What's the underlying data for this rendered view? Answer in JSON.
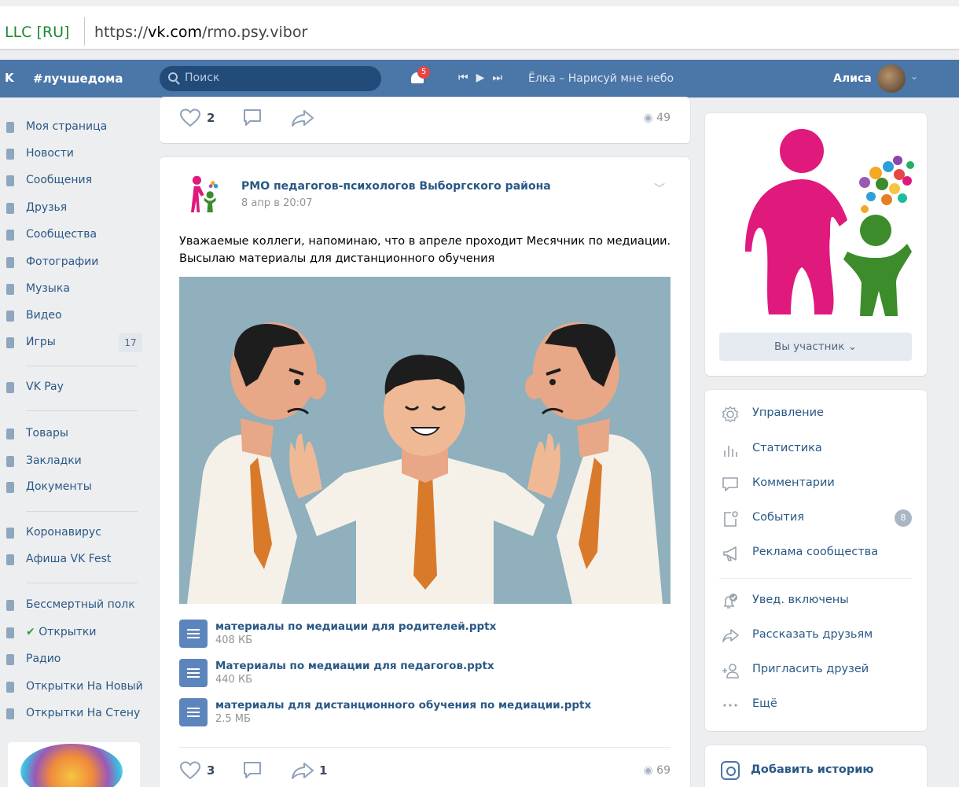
{
  "browser": {
    "cert": "LLC [RU]",
    "url_prefix": "https://",
    "url_domain": "vk.com",
    "url_path": "/rmo.psy.vibor"
  },
  "header": {
    "logo": "vk",
    "hashtag": "#лучшедома",
    "search_placeholder": "Поиск",
    "notifications_count": "5",
    "track": "Ёлка – Нарисуй мне небо",
    "user_name": "Алиса"
  },
  "nav": {
    "items": [
      {
        "label": "Моя страница"
      },
      {
        "label": "Новости"
      },
      {
        "label": "Сообщения"
      },
      {
        "label": "Друзья"
      },
      {
        "label": "Сообщества"
      },
      {
        "label": "Фотографии"
      },
      {
        "label": "Музыка"
      },
      {
        "label": "Видео"
      },
      {
        "label": "Игры",
        "count": "17"
      },
      {
        "label": "VK Pay"
      },
      {
        "label": "Товары"
      },
      {
        "label": "Закладки"
      },
      {
        "label": "Документы"
      },
      {
        "label": "Коронавирус"
      },
      {
        "label": "Афиша VK Fest"
      },
      {
        "label": "Бессмертный полк"
      },
      {
        "label": "Открытки",
        "check": "✔"
      },
      {
        "label": "Радио"
      },
      {
        "label": "Открытки На Новый"
      },
      {
        "label": "Открытки На Стену"
      }
    ]
  },
  "prev_post": {
    "likes": "2",
    "views": "49"
  },
  "post": {
    "author": "РМО педагогов-психологов Выборгского района",
    "date": "8 апр в 20:07",
    "text_line1": "Уважаемые коллеги, напоминаю, что в апреле проходит Месячник по медиации.",
    "text_line2": "Высылаю материалы для дистанционного обучения",
    "docs": [
      {
        "name": "материалы по медиации для родителей.pptx",
        "size": "408 КБ"
      },
      {
        "name": "Материалы по медиации для педагогов.pptx",
        "size": "440 КБ"
      },
      {
        "name": "материалы для дистанционного обучения по медиации.pptx",
        "size": "2.5 МБ"
      }
    ],
    "likes": "3",
    "shares": "1",
    "views": "69"
  },
  "group": {
    "member_button": "Вы участник",
    "menu": [
      {
        "label": "Управление",
        "icon": "gear-icon"
      },
      {
        "label": "Статистика",
        "icon": "stats-icon"
      },
      {
        "label": "Комментарии",
        "icon": "comment-icon"
      },
      {
        "label": "События",
        "icon": "events-icon",
        "count": "8"
      },
      {
        "label": "Реклама сообщества",
        "icon": "megaphone-icon"
      },
      {
        "label": "Увед. включены",
        "icon": "bell-check-icon"
      },
      {
        "label": "Рассказать друзьям",
        "icon": "share-icon"
      },
      {
        "label": "Пригласить друзей",
        "icon": "add-user-icon"
      },
      {
        "label": "Ещё",
        "icon": "more-icon"
      }
    ],
    "add_story": "Добавить историю"
  },
  "colors": {
    "header_bg": "#4a76a8",
    "link": "#2a5885",
    "page_bg": "#edeef0",
    "magenta": "#e0197d",
    "green": "#3c8c2c"
  }
}
